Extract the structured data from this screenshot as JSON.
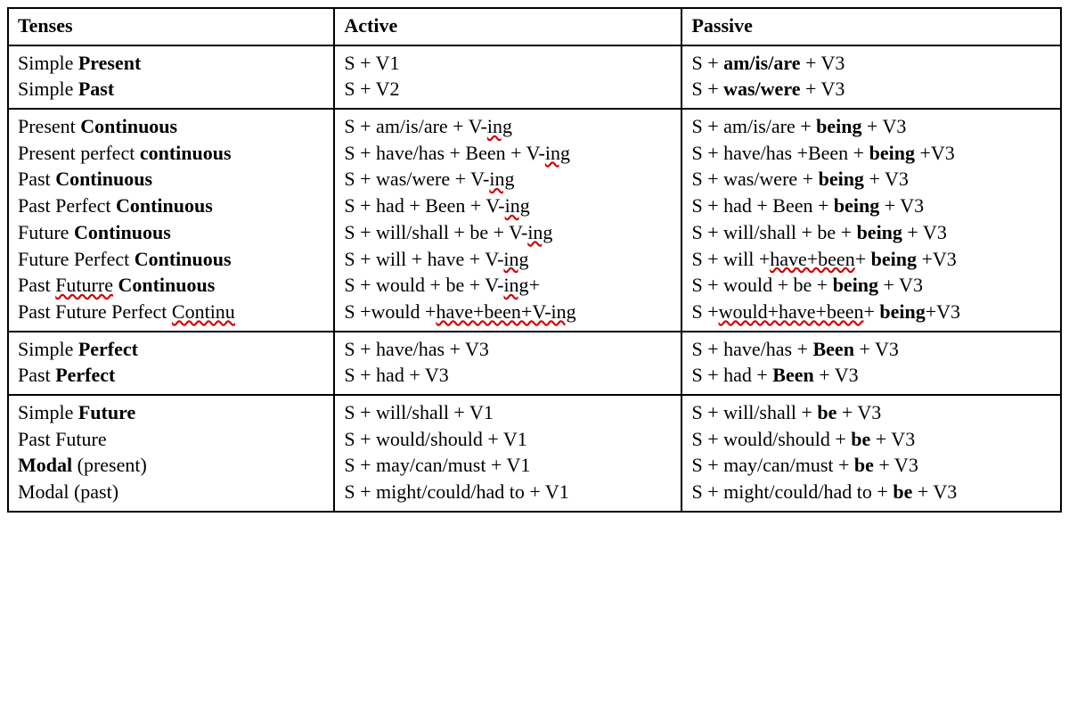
{
  "headers": {
    "tenses": "Tenses",
    "active": "Active",
    "passive": "Passive"
  },
  "r1": {
    "t1a": "Simple ",
    "t1b": "Present",
    "t2a": "Simple ",
    "t2b": "Past",
    "a1": "S + V1",
    "a2": "S + V2",
    "p1a": "S + ",
    "p1b": "am/is/are",
    "p1c": " + V3",
    "p2a": "S + ",
    "p2b": "was/were",
    "p2c": " + V3"
  },
  "r2": {
    "t1a": "Present ",
    "t1b": "Continuous",
    "t2a": "Present perfect ",
    "t2b": "continuous",
    "t3a": "Past ",
    "t3b": "Continuous",
    "t4a": "Past Perfect ",
    "t4b": "Continuous",
    "t5a": "Future ",
    "t5b": "Continuous",
    "t6a": "Future Perfect ",
    "t6b": "Continuous",
    "t7a": "Past ",
    "t7b": "Futurre",
    "t7c": " ",
    "t7d": "Continuous",
    "t8a": "Past Future Perfect ",
    "t8b": "Continu",
    "a1a": "S + am/is/are + V-",
    "a1b": "ing",
    "a2a": "S + have/has + Been + V-",
    "a2b": "ing",
    "a3a": "S + was/were + V-",
    "a3b": "ing",
    "a4a": "S + had + Been + V-",
    "a4b": "ing",
    "a5a": "S + will/shall + be + V-",
    "a5b": "ing",
    "a6a": "S + will + have + V-",
    "a6b": "ing",
    "a7a": "S + would + be + V-",
    "a7b": "ing",
    "a7c": "+",
    "a8a": "S +would +",
    "a8b": "have+been+V-ing",
    "p1a": "S + am/is/are + ",
    "p1b": "being",
    "p1c": " + V3",
    "p2a": "S + have/has +Been + ",
    "p2b": "being",
    "p2c": " +V3",
    "p3a": "S + was/were + ",
    "p3b": "being",
    "p3c": " + V3",
    "p4a": "S + had + Been + ",
    "p4b": "being",
    "p4c": " + V3",
    "p5a": "S + will/shall + be + ",
    "p5b": "being",
    "p5c": " + V3",
    "p6a": "S + will +",
    "p6b": "have+been",
    "p6c": "+ ",
    "p6d": "being",
    "p6e": " +V3",
    "p7a": "S + would + be + ",
    "p7b": "being",
    "p7c": " + V3",
    "p8a": "S +",
    "p8b": "would+have+been",
    "p8c": "+ ",
    "p8d": "being",
    "p8e": "+V3"
  },
  "r3": {
    "t1a": "Simple ",
    "t1b": "Perfect",
    "t2a": "Past ",
    "t2b": "Perfect",
    "a1": "S + have/has + V3",
    "a2": "S + had + V3",
    "p1a": "S + have/has + ",
    "p1b": "Been",
    "p1c": " + V3",
    "p2a": "S + had + ",
    "p2b": "Been",
    "p2c": " + V3"
  },
  "r4": {
    "t1a": "Simple ",
    "t1b": "Future",
    "t2": "Past Future",
    "t3a": "Modal",
    "t3b": " (present)",
    "t4": "Modal (past)",
    "a1": "S + will/shall + V1",
    "a2": "S + would/should + V1",
    "a3": "S + may/can/must + V1",
    "a4": "S + might/could/had to + V1",
    "p1a": "S + will/shall + ",
    "p1b": "be",
    "p1c": " + V3",
    "p2a": "S + would/should + ",
    "p2b": "be",
    "p2c": " + V3",
    "p3a": "S + may/can/must + ",
    "p3b": "be",
    "p3c": " + V3",
    "p4a": "S + might/could/had to + ",
    "p4b": "be",
    "p4c": " + V3"
  }
}
